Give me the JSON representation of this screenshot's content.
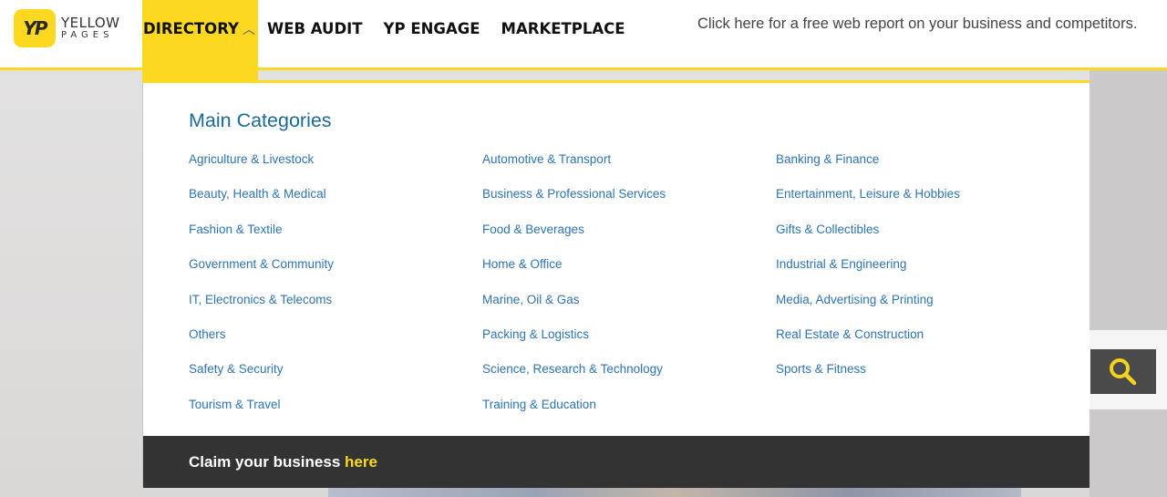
{
  "brand": {
    "badge": "YP",
    "name_line1": "YELLOW",
    "name_line2": "PAGES",
    "accent_color": "#fcd920"
  },
  "nav": {
    "items": [
      {
        "label": "DIRECTORY",
        "active": true,
        "icon": "chevron-up-icon"
      },
      {
        "label": "WEB AUDIT",
        "active": false
      },
      {
        "label": "YP ENGAGE",
        "active": false
      },
      {
        "label": "MARKETPLACE",
        "active": false
      }
    ],
    "chevron_glyph": "︿"
  },
  "promo": {
    "text": "Click here for a free web report on your business and competitors."
  },
  "dropdown": {
    "title": "Main Categories",
    "columns": [
      [
        "Agriculture & Livestock",
        "Beauty, Health & Medical",
        "Fashion & Textile",
        "Government & Community",
        "IT, Electronics & Telecoms",
        "Others",
        "Safety & Security",
        "Tourism & Travel"
      ],
      [
        "Automotive & Transport",
        "Business & Professional Services",
        "Food & Beverages",
        "Home & Office",
        "Marine, Oil & Gas",
        "Packing & Logistics",
        "Science, Research & Technology",
        "Training & Education"
      ],
      [
        "Banking & Finance",
        "Entertainment, Leisure & Hobbies",
        "Gifts & Collectibles",
        "Industrial & Engineering",
        "Media, Advertising & Printing",
        "Real Estate & Construction",
        "Sports & Fitness"
      ]
    ],
    "claim": {
      "text": "Claim your business ",
      "link": "here"
    }
  },
  "search": {
    "icon": "search-icon"
  }
}
